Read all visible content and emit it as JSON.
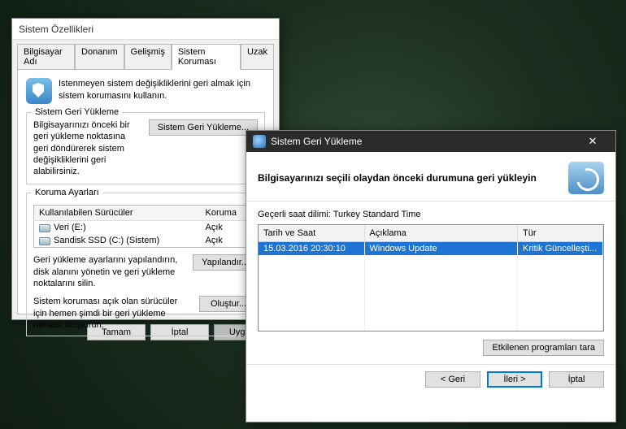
{
  "sysprops": {
    "title": "Sistem Özellikleri",
    "tabs": {
      "computer_name": "Bilgisayar Adı",
      "hardware": "Donanım",
      "advanced": "Gelişmiş",
      "system_protection": "Sistem Koruması",
      "remote": "Uzak"
    },
    "intro": "Istenmeyen sistem değişikliklerini geri almak için sistem korumasını kullanın.",
    "restore_section": {
      "legend": "Sistem Geri Yükleme",
      "text": "Bilgisayarınızı önceki bir geri yükleme noktasına geri döndürerek sistem değişikliklerini geri alabilirsiniz.",
      "button": "Sistem Geri Yükleme..."
    },
    "protection_section": {
      "legend": "Koruma Ayarları",
      "col_drive": "Kullanılabilen Sürücüler",
      "col_protection": "Koruma",
      "drives": [
        {
          "name": "Veri (E:)",
          "status": "Açık"
        },
        {
          "name": "Sandisk SSD (C:) (Sistem)",
          "status": "Açık"
        }
      ],
      "configure_text": "Geri yükleme ayarlarını yapılandırın, disk alanını yönetin ve geri yükleme noktalarını silin.",
      "configure_btn": "Yapılandır...",
      "create_text": "Sistem koruması açık olan sürücüler için hemen şimdi bir geri yükleme noktası oluşturun.",
      "create_btn": "Oluştur..."
    },
    "buttons": {
      "ok": "Tamam",
      "cancel": "İptal",
      "apply": "Uygula"
    }
  },
  "restore_wizard": {
    "title": "Sistem Geri Yükleme",
    "headline": "Bilgisayarınızı seçili olaydan önceki durumuna geri yükleyin",
    "timezone_label": "Geçerli saat dilimi:",
    "timezone_value": "Turkey Standard Time",
    "columns": {
      "datetime": "Tarih ve Saat",
      "description": "Açıklama",
      "type": "Tür"
    },
    "rows": [
      {
        "datetime": "15.03.2016 20:30:10",
        "description": "Windows Update",
        "type": "Kritik Güncelleşti..."
      }
    ],
    "scan_btn": "Etkilenen programları tara",
    "buttons": {
      "back": "< Geri",
      "next": "İleri >",
      "cancel": "İptal"
    }
  }
}
